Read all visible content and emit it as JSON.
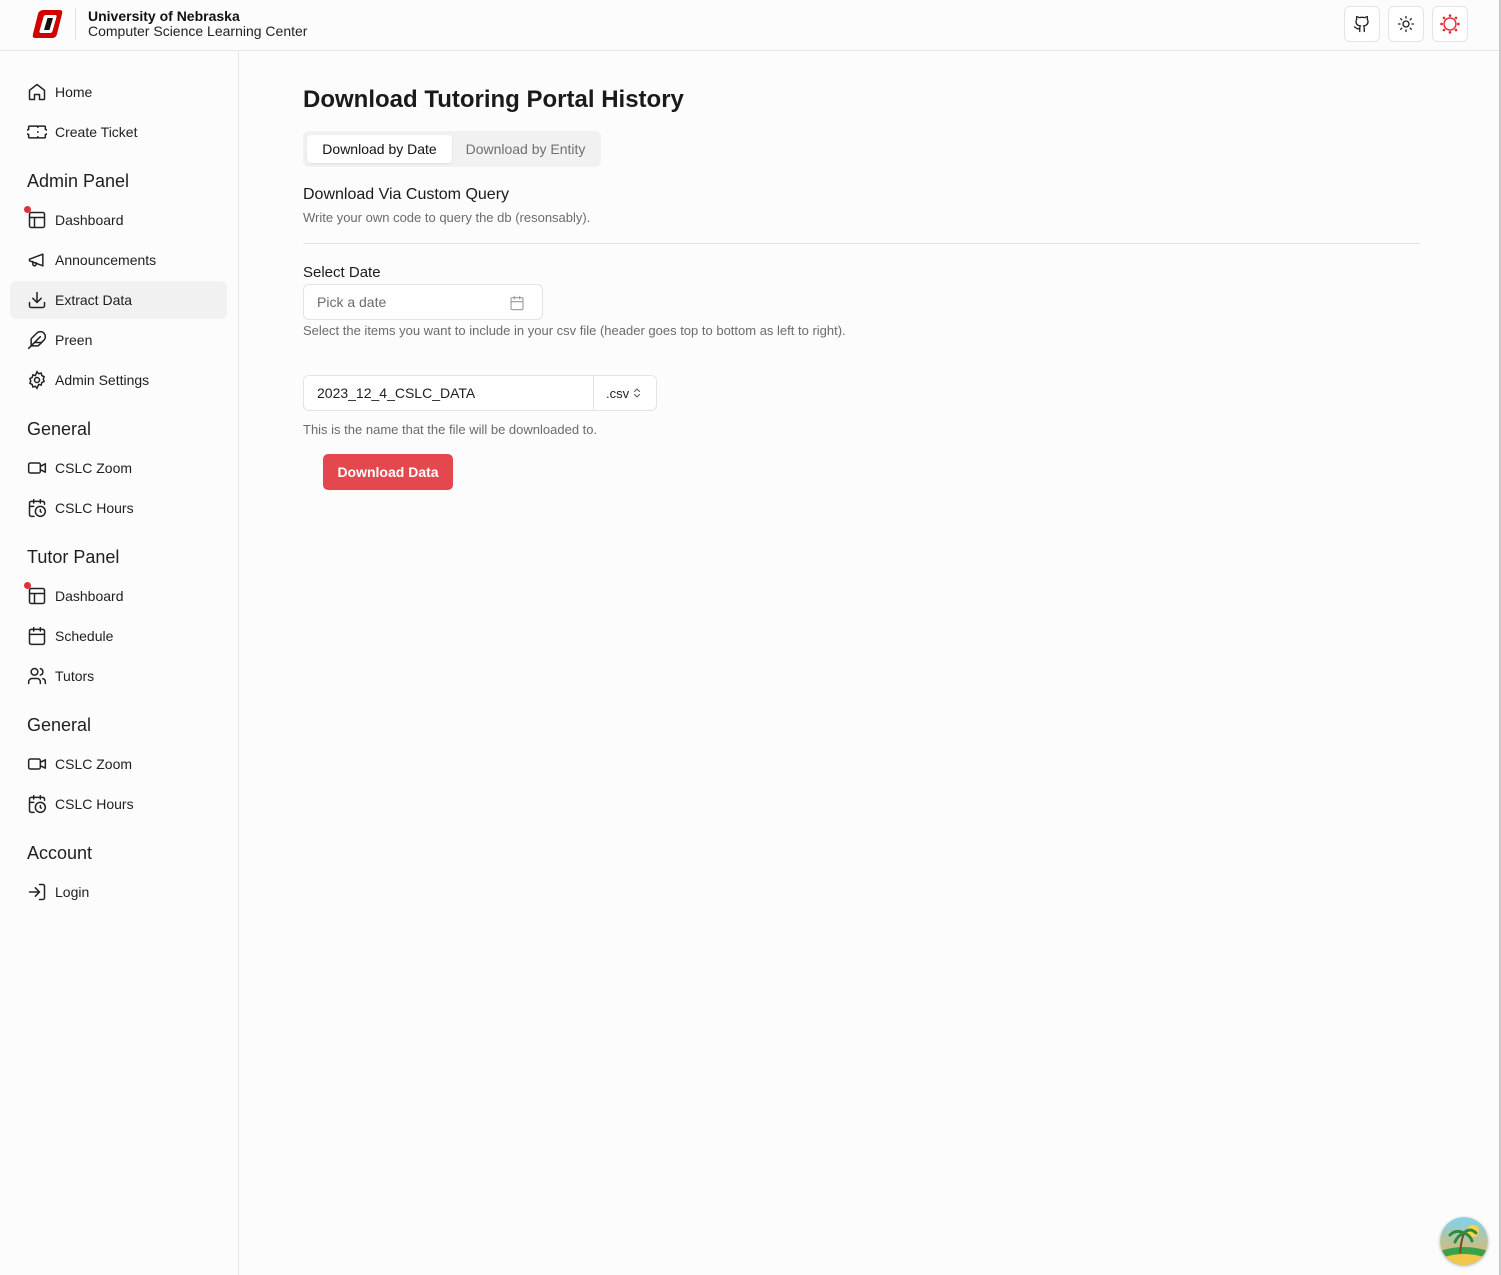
{
  "header": {
    "title": "University of Nebraska",
    "subtitle": "Computer Science Learning Center",
    "buttons": [
      "github-icon",
      "sun-icon",
      "canvas-icon"
    ]
  },
  "sidebar": {
    "top_items": [
      {
        "label": "Home",
        "icon": "home-icon"
      },
      {
        "label": "Create Ticket",
        "icon": "ticket-icon"
      }
    ],
    "admin_panel": {
      "title": "Admin Panel",
      "items": [
        {
          "label": "Dashboard",
          "icon": "dashboard-icon",
          "badge": true
        },
        {
          "label": "Announcements",
          "icon": "megaphone-icon"
        },
        {
          "label": "Extract Data",
          "icon": "download-icon",
          "active": true
        },
        {
          "label": "Preen",
          "icon": "feather-icon"
        },
        {
          "label": "Admin Settings",
          "icon": "gear-icon"
        }
      ]
    },
    "general_1": {
      "title": "General",
      "items": [
        {
          "label": "CSLC Zoom",
          "icon": "video-icon"
        },
        {
          "label": "CSLC Hours",
          "icon": "calendar-clock-icon"
        }
      ]
    },
    "tutor_panel": {
      "title": "Tutor Panel",
      "items": [
        {
          "label": "Dashboard",
          "icon": "dashboard-icon",
          "badge": true
        },
        {
          "label": "Schedule",
          "icon": "calendar-icon"
        },
        {
          "label": "Tutors",
          "icon": "users-icon"
        }
      ]
    },
    "general_2": {
      "title": "General",
      "items": [
        {
          "label": "CSLC Zoom",
          "icon": "video-icon"
        },
        {
          "label": "CSLC Hours",
          "icon": "calendar-clock-icon"
        }
      ]
    },
    "account": {
      "title": "Account",
      "items": [
        {
          "label": "Login",
          "icon": "login-icon"
        }
      ]
    }
  },
  "main": {
    "title": "Download Tutoring Portal History",
    "tabs": [
      {
        "label": "Download by Date",
        "active": true
      },
      {
        "label": "Download by Entity",
        "active": false
      }
    ],
    "section_heading": "Download Via Custom Query",
    "section_description": "Write your own code to query the db (resonsably).",
    "date_label": "Select Date",
    "date_placeholder": "Pick a date",
    "items_hint": "Select the items you want to include in your csv file (header goes top to bottom as left to right).",
    "filename_value": "2023_12_4_CSLC_DATA",
    "extension": ".csv",
    "filename_hint": "This is the name that the file will be downloaded to.",
    "download_button": "Download Data"
  },
  "colors": {
    "accent": "#e5474f",
    "badge": "#e0303a"
  }
}
